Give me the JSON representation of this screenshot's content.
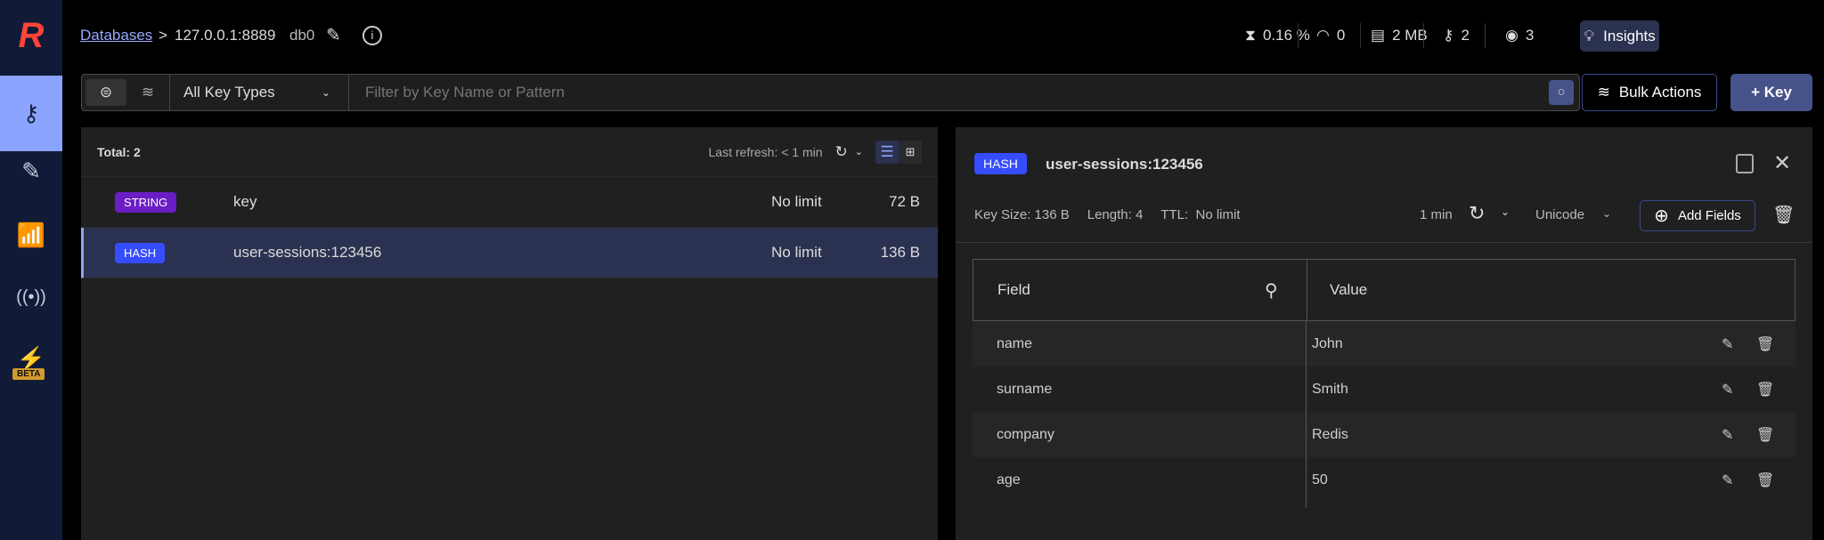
{
  "header": {
    "breadcrumb_link": "Databases",
    "breadcrumb_sep": ">",
    "host": "127.0.0.1:8889",
    "db": "db0",
    "stats": {
      "cpu": "0.16 %",
      "ops": "0",
      "memory": "2 MB",
      "keys": "2",
      "clients": "3"
    },
    "insights_label": "Insights"
  },
  "sidebar": {
    "beta_label": "BETA"
  },
  "filter": {
    "key_type": "All Key Types",
    "placeholder": "Filter by Key Name or Pattern",
    "bulk_label": "Bulk Actions",
    "add_key_label": "+ Key"
  },
  "list": {
    "total": "Total: 2",
    "last_refresh": "Last refresh: < 1 min",
    "rows": [
      {
        "type": "STRING",
        "type_color": "#6a1dc4",
        "name": "key",
        "ttl": "No limit",
        "size": "72 B"
      },
      {
        "type": "HASH",
        "type_color": "#364cff",
        "name": "user-sessions:123456",
        "ttl": "No limit",
        "size": "136 B"
      }
    ]
  },
  "detail": {
    "type": "HASH",
    "name": "user-sessions:123456",
    "key_size": "Key Size: 136 B",
    "length": "Length: 4",
    "ttl_label": "TTL:",
    "ttl": "No limit",
    "refresh": "1 min",
    "format": "Unicode",
    "add_fields": "Add Fields",
    "columns": [
      "Field",
      "Value"
    ],
    "fields": [
      {
        "field": "name",
        "value": "John"
      },
      {
        "field": "surname",
        "value": "Smith"
      },
      {
        "field": "company",
        "value": "Redis"
      },
      {
        "field": "age",
        "value": "50"
      }
    ]
  }
}
